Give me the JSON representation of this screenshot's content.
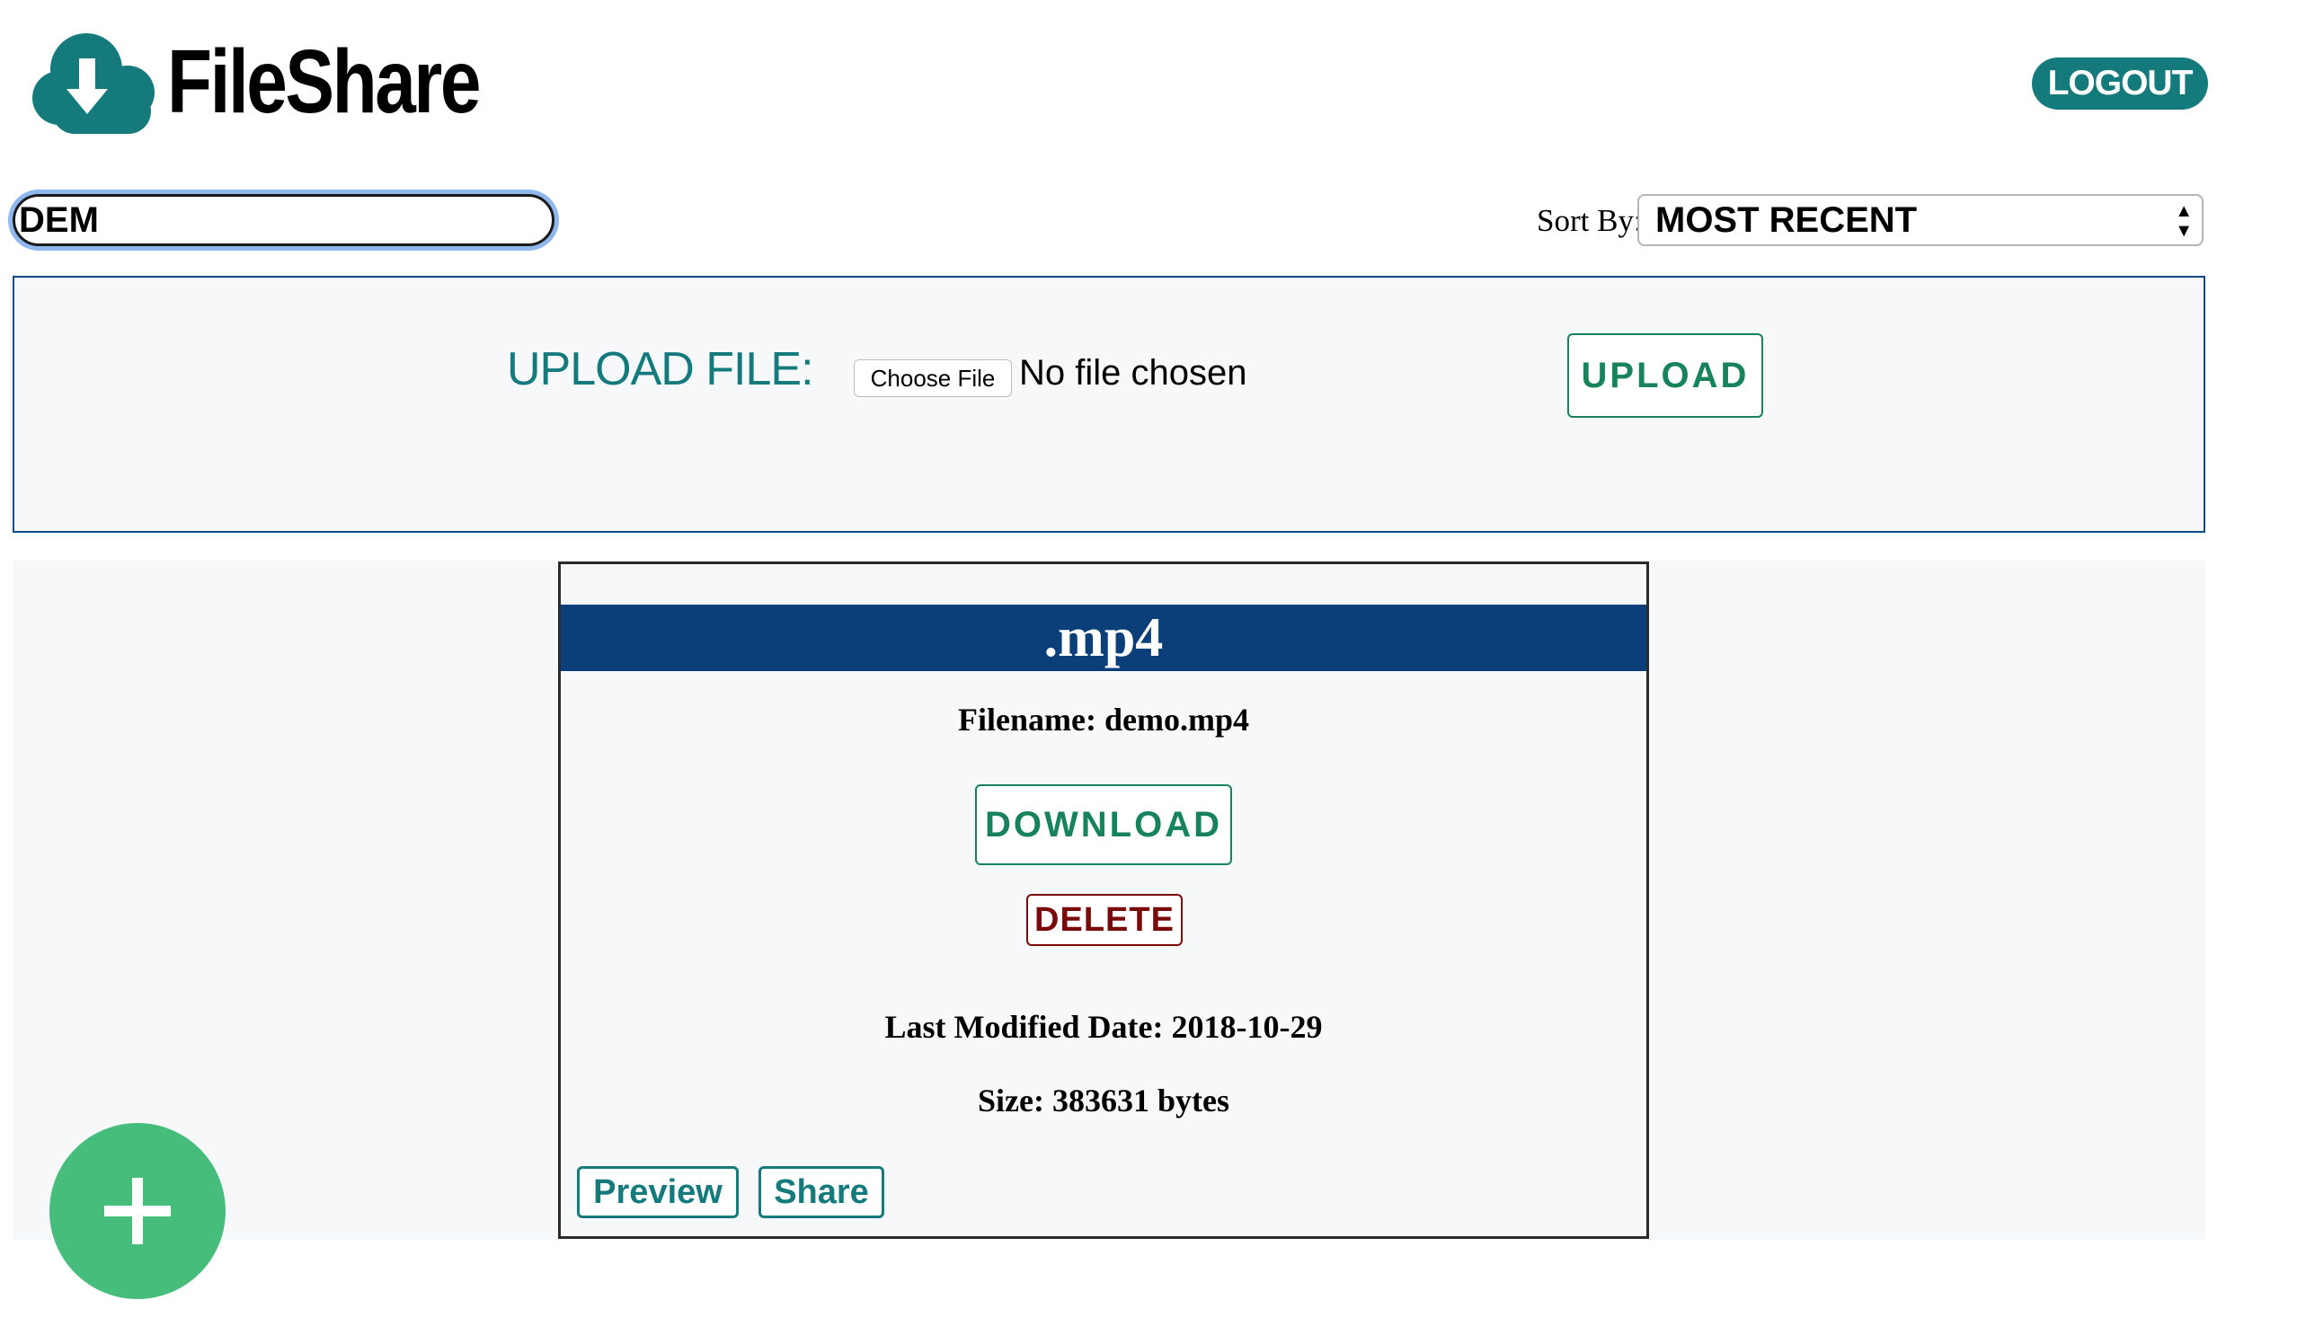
{
  "app": {
    "title": "FileShare",
    "logout_label": "LOGOUT"
  },
  "search": {
    "value": "DEM"
  },
  "sort": {
    "label": "Sort By:",
    "selected": "MOST RECENT"
  },
  "upload": {
    "label": "UPLOAD FILE:",
    "choose_file_label": "Choose File",
    "no_file_text": "No file chosen",
    "upload_button": "UPLOAD"
  },
  "files": [
    {
      "extension": ".mp4",
      "filename_text": "Filename: demo.mp4",
      "download_label": "DOWNLOAD",
      "delete_label": "DELETE",
      "modified_text": "Last Modified Date: 2018-10-29",
      "size_text": "Size: 383631 bytes",
      "preview_label": "Preview",
      "share_label": "Share"
    }
  ],
  "icons": {
    "logo": "cloud-download-icon",
    "fab": "plus-icon",
    "sort_arrows": "updown-arrows-icon"
  },
  "colors": {
    "brand_teal": "#157a7c",
    "header_blue": "#0a3f7a",
    "action_green": "#16835a",
    "delete_red": "#7a0a0a",
    "fab_green": "#47bd7c"
  }
}
